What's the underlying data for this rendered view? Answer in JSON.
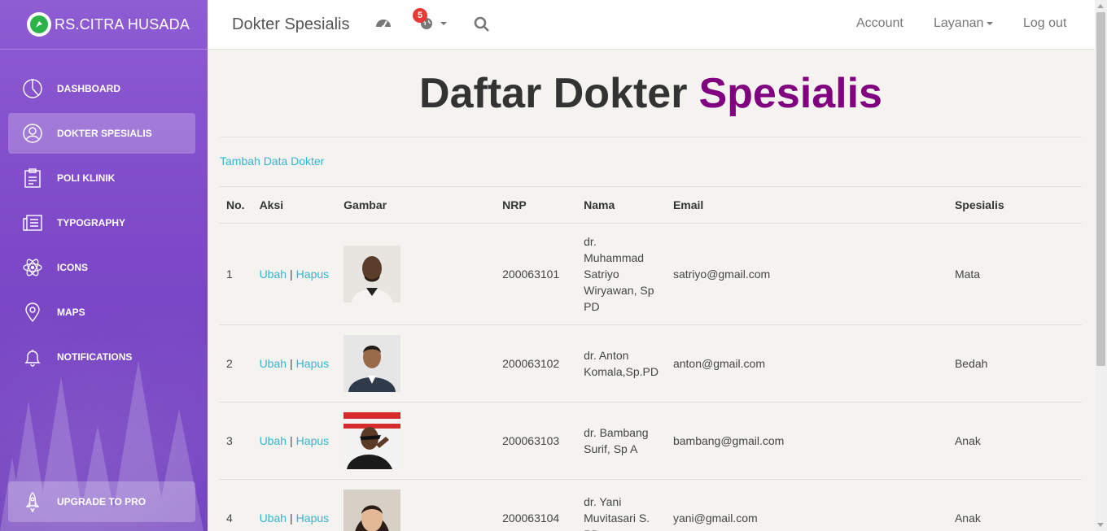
{
  "brand": {
    "title": "RS.CITRA HUSADA"
  },
  "sidebar": {
    "items": [
      {
        "label": "DASHBOARD",
        "icon": "pie-chart-icon",
        "active": false
      },
      {
        "label": "DOKTER SPESIALIS",
        "icon": "user-circle-icon",
        "active": true
      },
      {
        "label": "POLI KLINIK",
        "icon": "clipboard-icon",
        "active": false
      },
      {
        "label": "TYPOGRAPHY",
        "icon": "newspaper-icon",
        "active": false
      },
      {
        "label": "ICONS",
        "icon": "atom-icon",
        "active": false
      },
      {
        "label": "MAPS",
        "icon": "map-pin-icon",
        "active": false
      },
      {
        "label": "NOTIFICATIONS",
        "icon": "bell-icon",
        "active": false
      }
    ],
    "upgrade_label": "UPGRADE TO PRO"
  },
  "topbar": {
    "page_title": "Dokter Spesialis",
    "notification_count": "5",
    "account_label": "Account",
    "services_label": "Layanan",
    "logout_label": "Log out"
  },
  "main": {
    "heading_plain": "Daftar Dokter",
    "heading_accent": "Spesialis",
    "accent_color": "#800080",
    "link_color": "#35b5d3",
    "add_link": "Tambah Data Dokter",
    "columns": [
      "No.",
      "Aksi",
      "Gambar",
      "NRP",
      "Nama",
      "Email",
      "Spesialis"
    ],
    "edit_label": "Ubah",
    "delete_label": "Hapus",
    "action_separator": "|",
    "rows": [
      {
        "no": "1",
        "nrp": "200063101",
        "nama": "dr. Muhammad Satriyo Wiryawan, Sp PD",
        "email": "satriyo@gmail.com",
        "spesialis": "Mata"
      },
      {
        "no": "2",
        "nrp": "200063102",
        "nama": "dr. Anton Komala,Sp.PD",
        "email": "anton@gmail.com",
        "spesialis": "Bedah"
      },
      {
        "no": "3",
        "nrp": "200063103",
        "nama": "dr. Bambang Surif, Sp A",
        "email": "bambang@gmail.com",
        "spesialis": "Anak"
      },
      {
        "no": "4",
        "nrp": "200063104",
        "nama": "dr. Yani Muvitasari S. PD",
        "email": "yani@gmail.com",
        "spesialis": "Anak"
      }
    ]
  }
}
